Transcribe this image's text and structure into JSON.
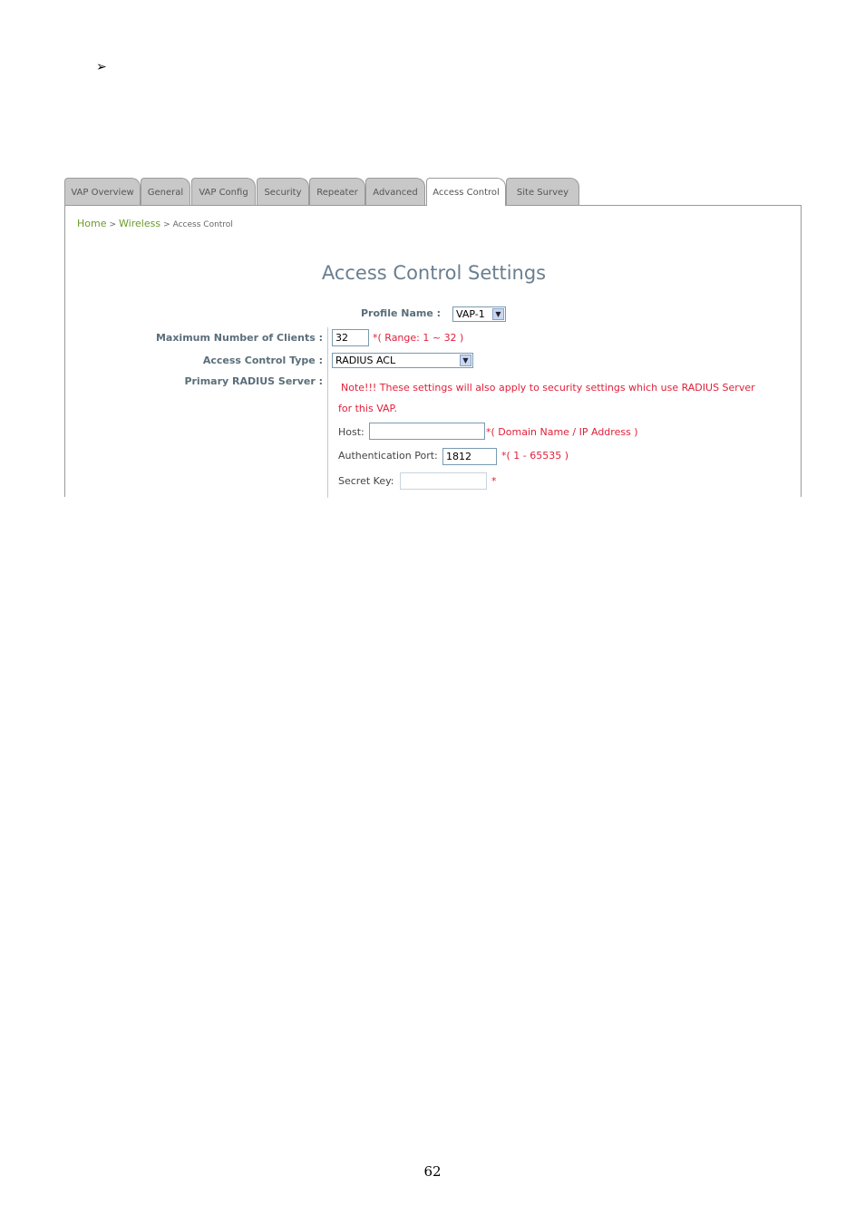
{
  "bullet": "➢",
  "tabs": [
    {
      "label": "VAP Overview"
    },
    {
      "label": "General"
    },
    {
      "label": "VAP Config"
    },
    {
      "label": "Security"
    },
    {
      "label": "Repeater"
    },
    {
      "label": "Advanced"
    },
    {
      "label": "Access Control"
    },
    {
      "label": "Site Survey"
    }
  ],
  "active_tab": "Access Control",
  "breadcrumb": {
    "home": "Home",
    "sep": ">",
    "wireless": "Wireless",
    "current": "Access Control"
  },
  "title": "Access Control Settings",
  "profile": {
    "label": "Profile Name :",
    "value": "VAP-1"
  },
  "max_clients": {
    "label": "Maximum Number of Clients :",
    "value": "32",
    "hint": "*( Range: 1 ~ 32 )"
  },
  "access_type": {
    "label": "Access Control Type :",
    "value": "RADIUS ACL"
  },
  "radius": {
    "label": "Primary RADIUS Server :",
    "note_line1": "Note!!! These settings will also apply to security settings which use RADIUS Server",
    "note_line2": "for this VAP.",
    "host_label": "Host:",
    "host_value": "",
    "host_hint": "*( Domain Name / IP Address )",
    "port_label": "Authentication Port:",
    "port_value": "1812",
    "port_hint": "*( 1 - 65535 )",
    "secret_label": "Secret Key:",
    "secret_value": "",
    "secret_hint": "*"
  },
  "page_number": "62",
  "colors": {
    "link_green": "#6a9a2a",
    "label_slate": "#5a6e7a",
    "title_slate": "#6a7f90",
    "warning_red": "#e0203a"
  }
}
